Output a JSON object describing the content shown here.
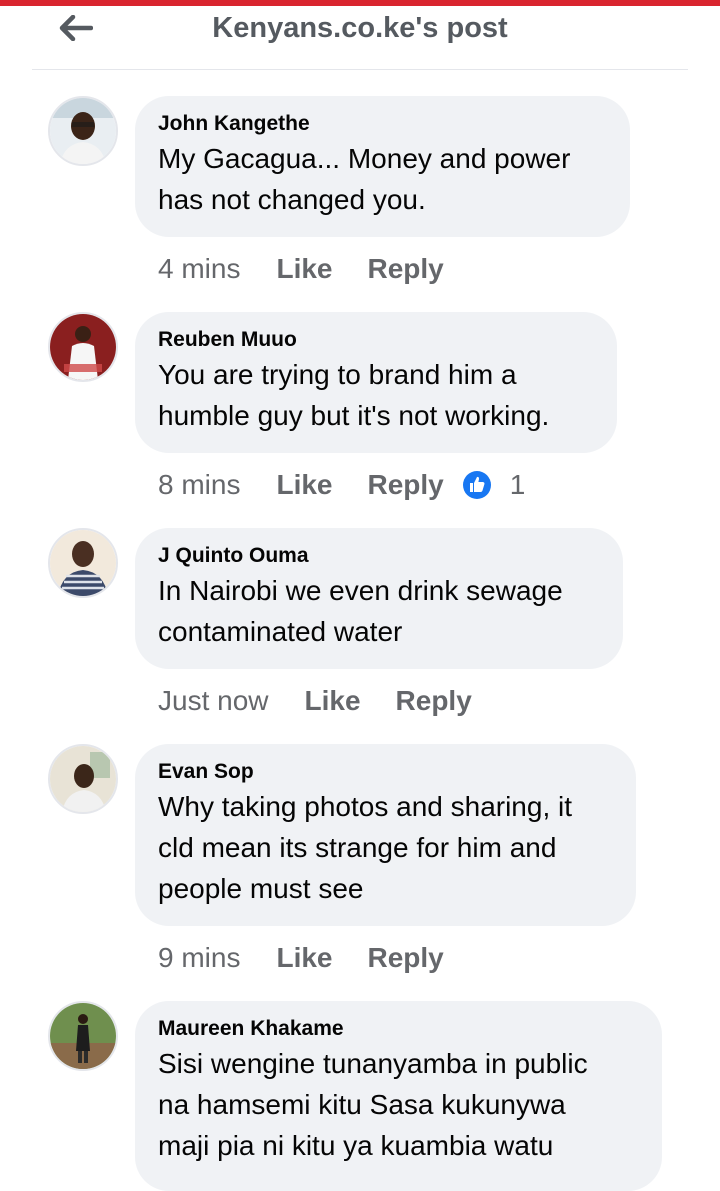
{
  "header": {
    "title": "Kenyans.co.ke's post"
  },
  "colors": {
    "accent": "#d9252f",
    "bubble": "#f0f2f5",
    "like_blue": "#1877f2",
    "muted": "#65676b"
  },
  "comments": [
    {
      "author": "John Kangethe",
      "text": "My Gacagua... Money and power\nhas not changed you.",
      "time": "4 mins",
      "like": "Like",
      "reply": "Reply",
      "avatar_icon": "avatar-man-white-shirt"
    },
    {
      "author": "Reuben Muuo",
      "text": "You are trying to brand him a\nhumble guy but it's not working.",
      "time": "8 mins",
      "like": "Like",
      "reply": "Reply",
      "reaction_count": "1",
      "avatar_icon": "avatar-man-red-background"
    },
    {
      "author": "J Quinto Ouma",
      "text": "In Nairobi we even drink sewage\ncontaminated water",
      "time": "Just now",
      "like": "Like",
      "reply": "Reply",
      "avatar_icon": "avatar-man-striped-shirt"
    },
    {
      "author": "Evan Sop",
      "text": "Why taking photos and sharing, it\ncld mean its strange for him and\npeople must see",
      "time": "9 mins",
      "like": "Like",
      "reply": "Reply",
      "avatar_icon": "avatar-man-office"
    },
    {
      "author": "Maureen Khakame",
      "text": "Sisi wengine tunanyamba  in public\nna hamsemi kitu Sasa kukunywa\nmaji pia ni kitu ya kuambia watu",
      "avatar_icon": "avatar-person-outdoors"
    }
  ]
}
